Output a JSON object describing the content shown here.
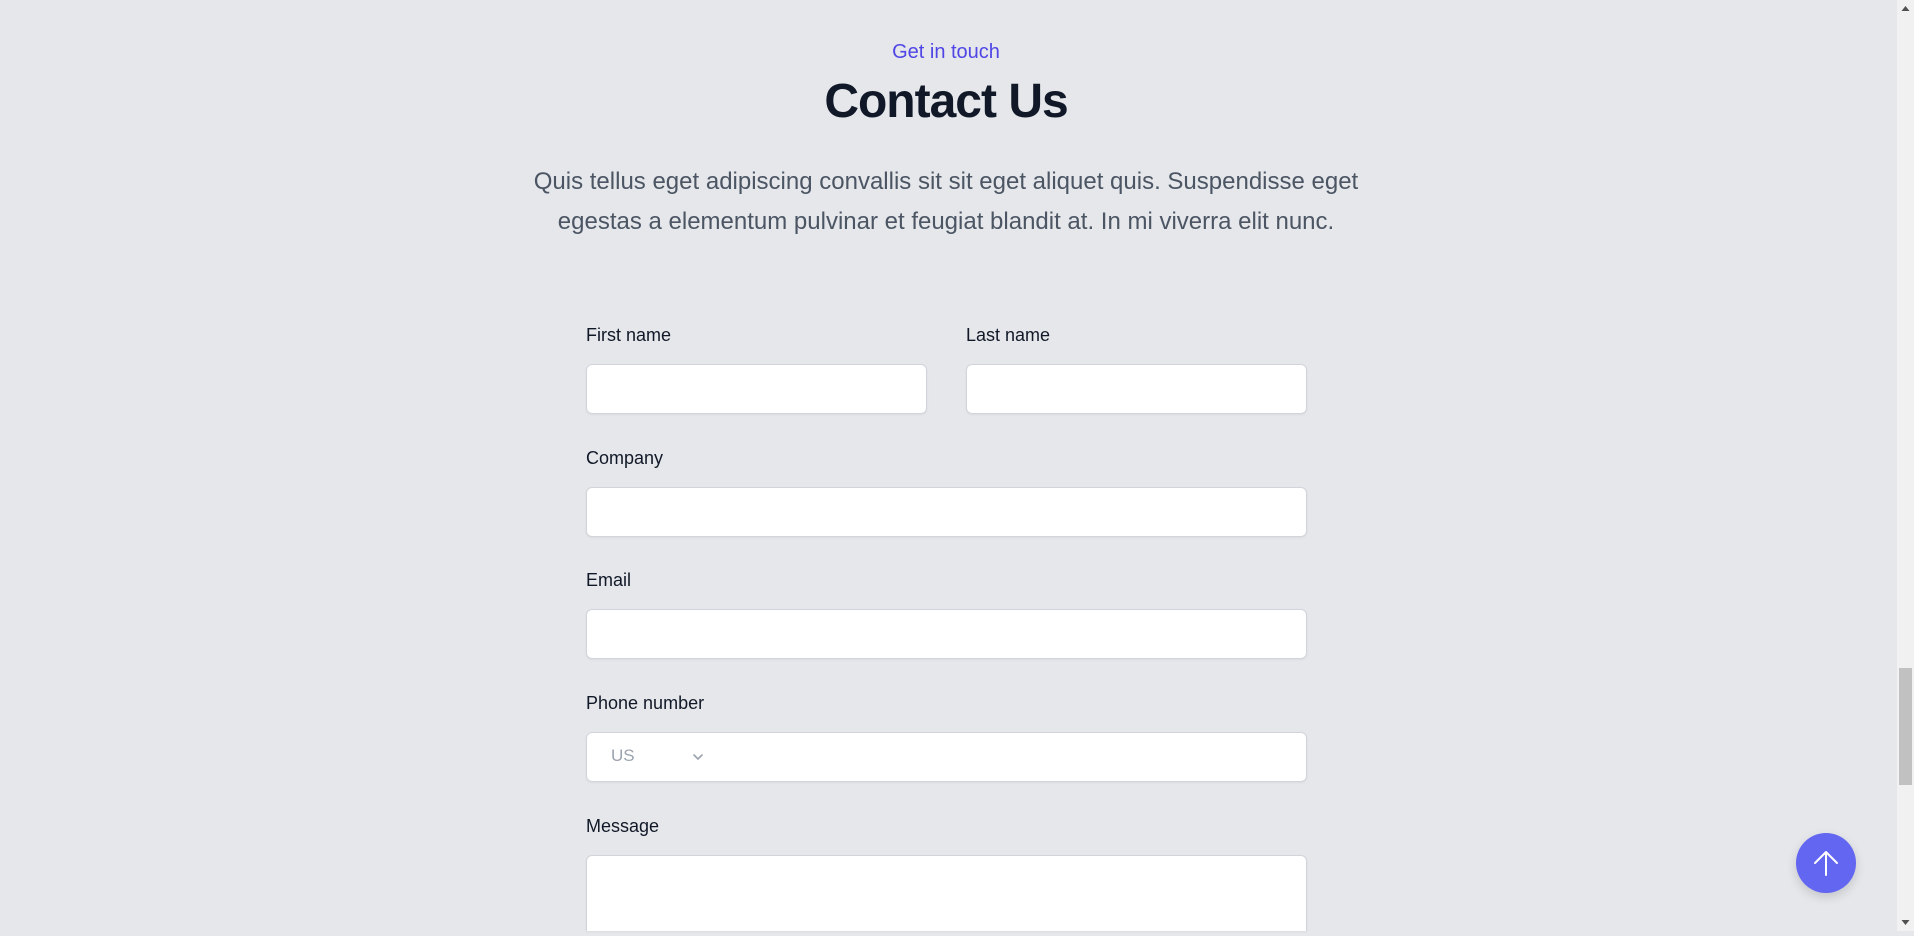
{
  "section": {
    "eyebrow": "Get in touch",
    "title": "Contact Us",
    "description": "Quis tellus eget adipiscing convallis sit sit eget aliquet quis. Suspendisse eget egestas a elementum pulvinar et feugiat blandit at. In mi viverra elit nunc."
  },
  "form": {
    "first_name_label": "First name",
    "first_name_value": "",
    "last_name_label": "Last name",
    "last_name_value": "",
    "company_label": "Company",
    "company_value": "",
    "email_label": "Email",
    "email_value": "",
    "phone_label": "Phone number",
    "phone_country": "US",
    "phone_value": "",
    "message_label": "Message",
    "message_value": ""
  },
  "icons": {
    "country_dropdown": "chevron-down-icon",
    "back_to_top": "arrow-up-icon",
    "scroll_up": "triangle-up-icon",
    "scroll_down": "triangle-down-icon"
  },
  "colors": {
    "accent": "#4f46e5",
    "back_to_top_button": "#6366f1",
    "page_background": "#e5e7eb",
    "heading": "#111827",
    "body_text": "#4b5563"
  }
}
